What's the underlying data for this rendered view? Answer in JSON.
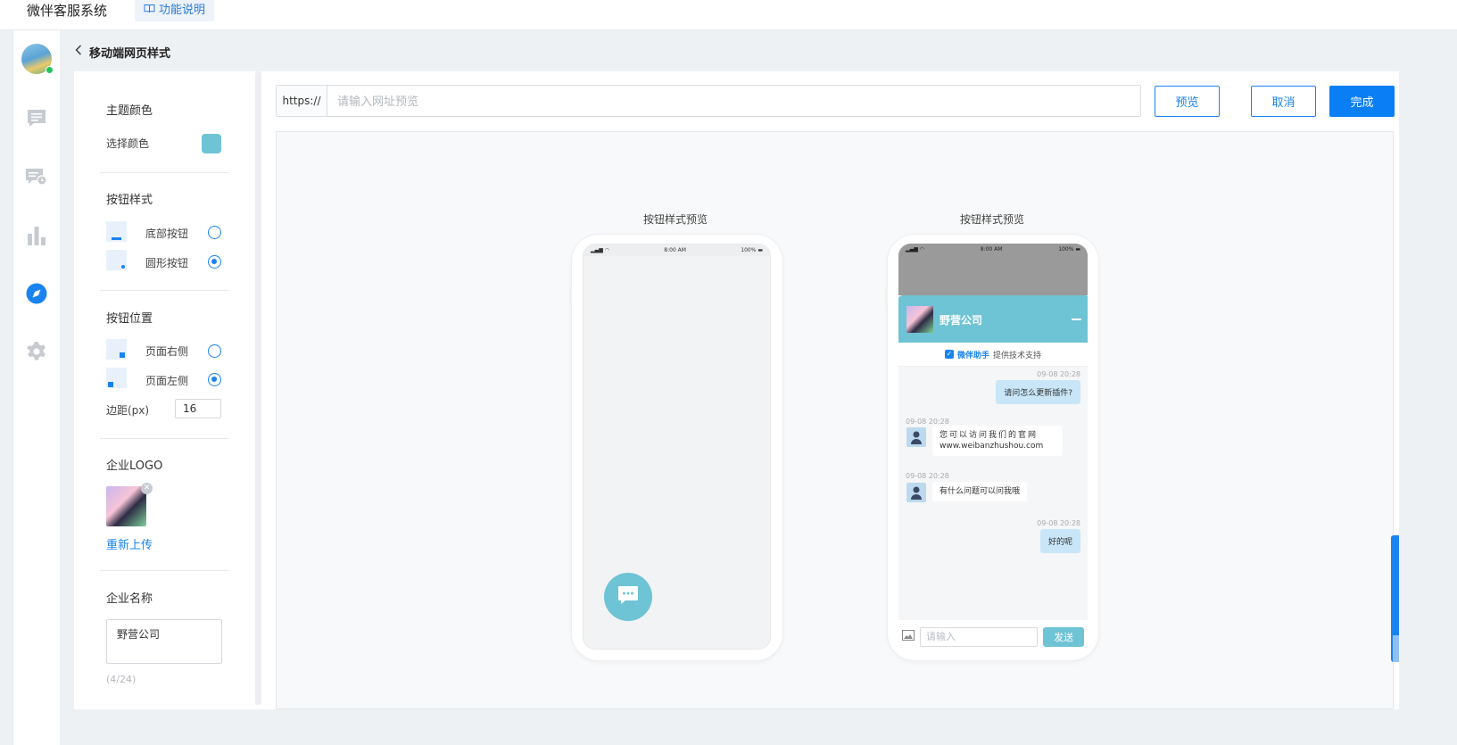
{
  "header": {
    "app_title": "微伴客服系统",
    "help_label": "功能说明"
  },
  "page": {
    "back_title": "移动端网页样式"
  },
  "settings": {
    "theme": {
      "title": "主题颜色",
      "pick_label": "选择颜色",
      "color": "#6ec3d4"
    },
    "button_style": {
      "title": "按钮样式",
      "options": [
        {
          "label": "底部按钮",
          "selected": false
        },
        {
          "label": "圆形按钮",
          "selected": true
        }
      ]
    },
    "button_position": {
      "title": "按钮位置",
      "options": [
        {
          "label": "页面右侧",
          "selected": false
        },
        {
          "label": "页面左侧",
          "selected": true
        }
      ],
      "margin_label": "边距(px)",
      "margin_value": "16"
    },
    "logo": {
      "title": "企业LOGO",
      "reupload": "重新上传"
    },
    "company": {
      "title": "企业名称",
      "value": "野营公司",
      "count": "(4/24)"
    }
  },
  "toolbar": {
    "url_prefix": "https://",
    "url_placeholder": "请输入网址预览",
    "preview_label": "预览",
    "cancel_label": "取消",
    "done_label": "完成"
  },
  "preview": {
    "left_label": "按钮样式预览",
    "right_label": "按钮样式预览",
    "status_time": "8:00 AM",
    "status_battery": "100%",
    "chat": {
      "company_name": "野营公司",
      "support_brand": "微伴助手",
      "support_text": "提供技术支持",
      "messages": [
        {
          "time": "09-08 20:28",
          "side": "right",
          "text": "请问怎么更新插件?"
        },
        {
          "time": "09-08 20:28",
          "side": "left",
          "text": "您可以访问我们的官网 www.weibanzhushou.com"
        },
        {
          "time": "09-08 20:28",
          "side": "left",
          "text": "有什么问题可以问我哦"
        },
        {
          "time": "09-08 20:28",
          "side": "right",
          "text": "好的呢"
        }
      ],
      "msg1_time": "09-08 20:28",
      "msg1_text": "请问怎么更新插件?",
      "msg2_time": "09-08 20:28",
      "msg2_line1": "您可以访问我们的官网",
      "msg2_line2": "www.weibanzhushou.com",
      "msg3_time": "09-08 20:28",
      "msg3_text": "有什么问题可以问我哦",
      "msg4_time": "09-08 20:28",
      "msg4_text": "好的呢",
      "input_placeholder": "请输入",
      "send_label": "发送"
    }
  },
  "colors": {
    "accent": "#1a83f0",
    "primary_button": "#0a7ff5",
    "theme": "#6ec3d4"
  }
}
